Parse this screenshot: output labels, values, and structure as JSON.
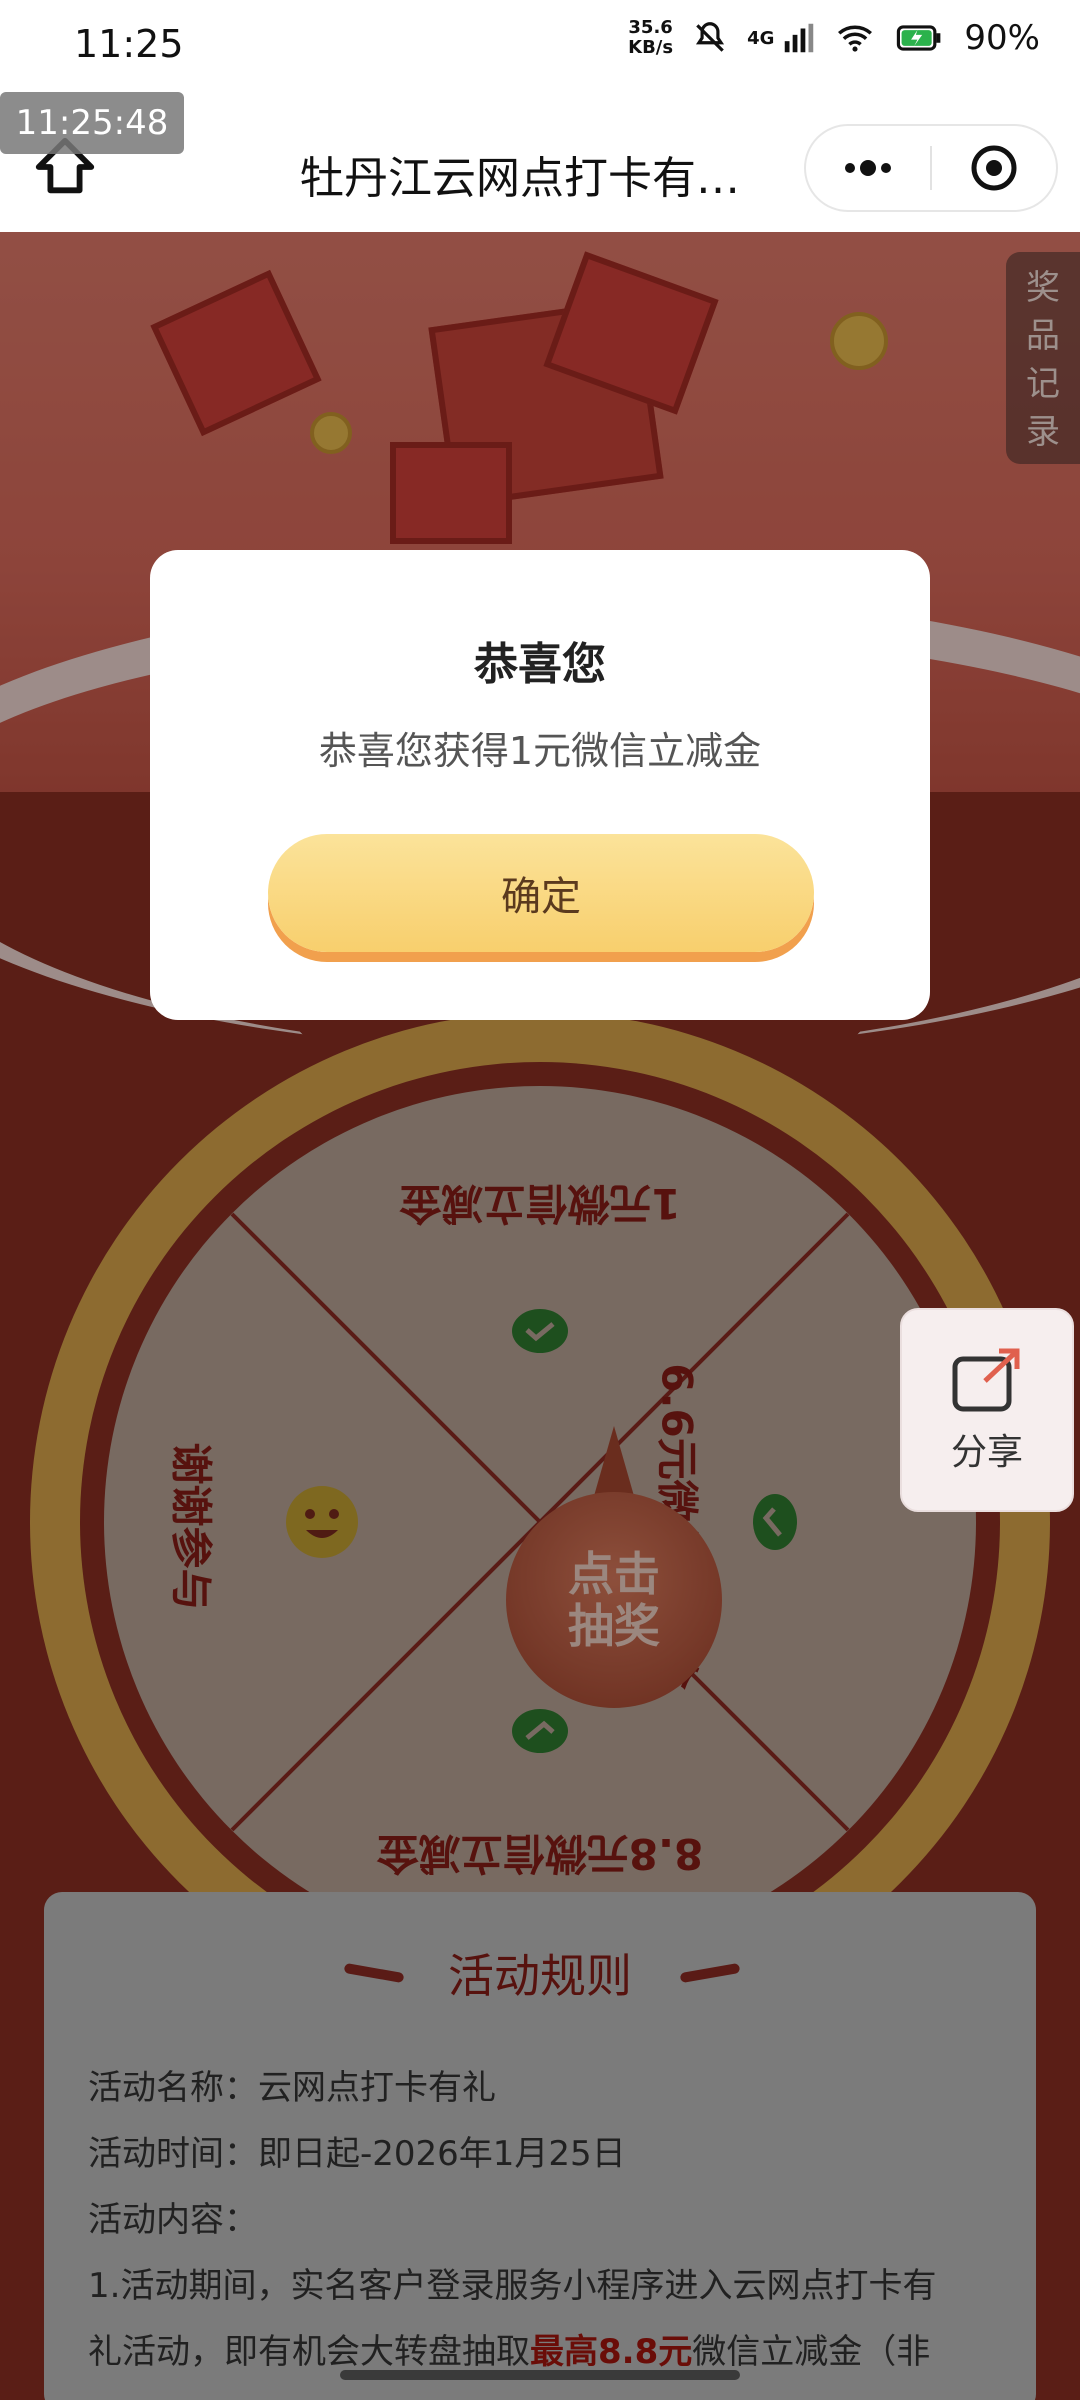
{
  "status_bar": {
    "time": "11:25",
    "speed_value": "35.6",
    "speed_unit": "KB/s",
    "network": "4G",
    "battery": "90%"
  },
  "timestamp_overlay": "11:25:48",
  "nav": {
    "title": "牡丹江云网点打卡有…"
  },
  "side": {
    "prize_record": "奖品记录"
  },
  "wheel": {
    "segments": {
      "top": "1元微信立减金",
      "right": "6.6元微信立减金",
      "bottom": "8.8元微信立减金",
      "left": "谢谢参与"
    },
    "center_line1": "点击",
    "center_line2": "抽奖"
  },
  "share": {
    "label": "分享"
  },
  "rules": {
    "title": "活动规则",
    "name": "活动名称：云网点打卡有礼",
    "time": "活动时间：即日起-2026年1月25日",
    "content_label": "活动内容：",
    "item1_line1": "1.活动期间，实名客户登录服务小程序进入云网点打卡有",
    "item1_line2_a": "礼活动，即有机会大转盘抽取",
    "item1_line2_highlight": "最高8.8元",
    "item1_line2_b": "微信立减金（非"
  },
  "modal": {
    "title": "恭喜您",
    "message": "恭喜您获得1元微信立减金",
    "confirm": "确定"
  },
  "colors": {
    "accent_red": "#861d16",
    "button_gold": "#f8cf6d"
  }
}
